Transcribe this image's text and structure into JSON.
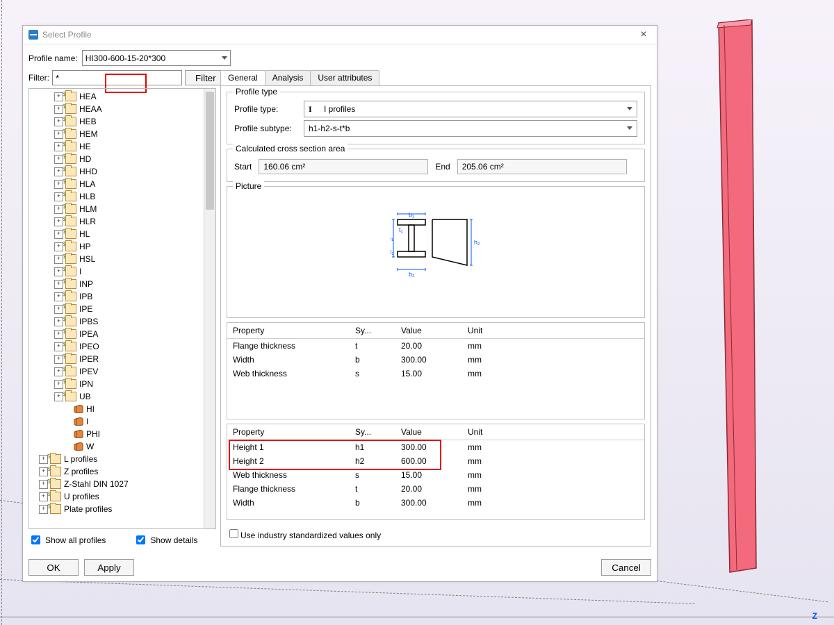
{
  "dialog": {
    "title": "Select Profile",
    "profile_name_label": "Profile name:",
    "profile_name_value": "HI300-600-15-20*300",
    "filter_label": "Filter:",
    "filter_value": "*",
    "filter_button": "Filter",
    "show_all_profiles": "Show all profiles",
    "show_details": "Show details",
    "ok": "OK",
    "apply": "Apply",
    "cancel": "Cancel"
  },
  "tree": {
    "items_folder": [
      "HEA",
      "HEAA",
      "HEB",
      "HEM",
      "HE",
      "HD",
      "HHD",
      "HLA",
      "HLB",
      "HLM",
      "HLR",
      "HL",
      "HP",
      "HSL",
      "I",
      "INP",
      "IPB",
      "IPE",
      "IPBS",
      "IPEA",
      "IPEO",
      "IPER",
      "IPEV",
      "IPN",
      "UB"
    ],
    "items_beam": [
      "HI",
      "I",
      "PHI",
      "W"
    ],
    "items_shape": [
      {
        "glyph": "L",
        "label": "L profiles"
      },
      {
        "glyph": "L",
        "label": "Z profiles"
      },
      {
        "glyph": "Z",
        "label": "Z-Stahl DIN 1027"
      },
      {
        "glyph": "U",
        "label": "U profiles"
      },
      {
        "glyph": "P",
        "label": "Plate profiles"
      }
    ]
  },
  "tabs": {
    "general": "General",
    "analysis": "Analysis",
    "user": "User attributes"
  },
  "profile_type": {
    "group_title": "Profile type",
    "type_label": "Profile type:",
    "type_value": "I profiles",
    "subtype_label": "Profile subtype:",
    "subtype_value": "h1-h2-s-t*b"
  },
  "calc": {
    "title": "Calculated cross section area",
    "start_label": "Start",
    "start_value": "160.06 cm²",
    "end_label": "End",
    "end_value": "205.06 cm²"
  },
  "picture": {
    "title": "Picture"
  },
  "headers": {
    "prop": "Property",
    "sym": "Sy...",
    "val": "Value",
    "unit": "Unit"
  },
  "table_a": [
    {
      "prop": "Flange thickness",
      "sym": "t",
      "val": "20.00",
      "unit": "mm"
    },
    {
      "prop": "Width",
      "sym": "b",
      "val": "300.00",
      "unit": "mm"
    },
    {
      "prop": "Web thickness",
      "sym": "s",
      "val": "15.00",
      "unit": "mm"
    }
  ],
  "table_b": [
    {
      "prop": "Height 1",
      "sym": "h1",
      "val": "300.00",
      "unit": "mm"
    },
    {
      "prop": "Height 2",
      "sym": "h2",
      "val": "600.00",
      "unit": "mm"
    },
    {
      "prop": "Web thickness",
      "sym": "s",
      "val": "15.00",
      "unit": "mm"
    },
    {
      "prop": "Flange thickness",
      "sym": "t",
      "val": "20.00",
      "unit": "mm"
    },
    {
      "prop": "Width",
      "sym": "b",
      "val": "300.00",
      "unit": "mm"
    }
  ],
  "std_only": "Use industry standardized values only",
  "axis": {
    "z": "Z"
  }
}
